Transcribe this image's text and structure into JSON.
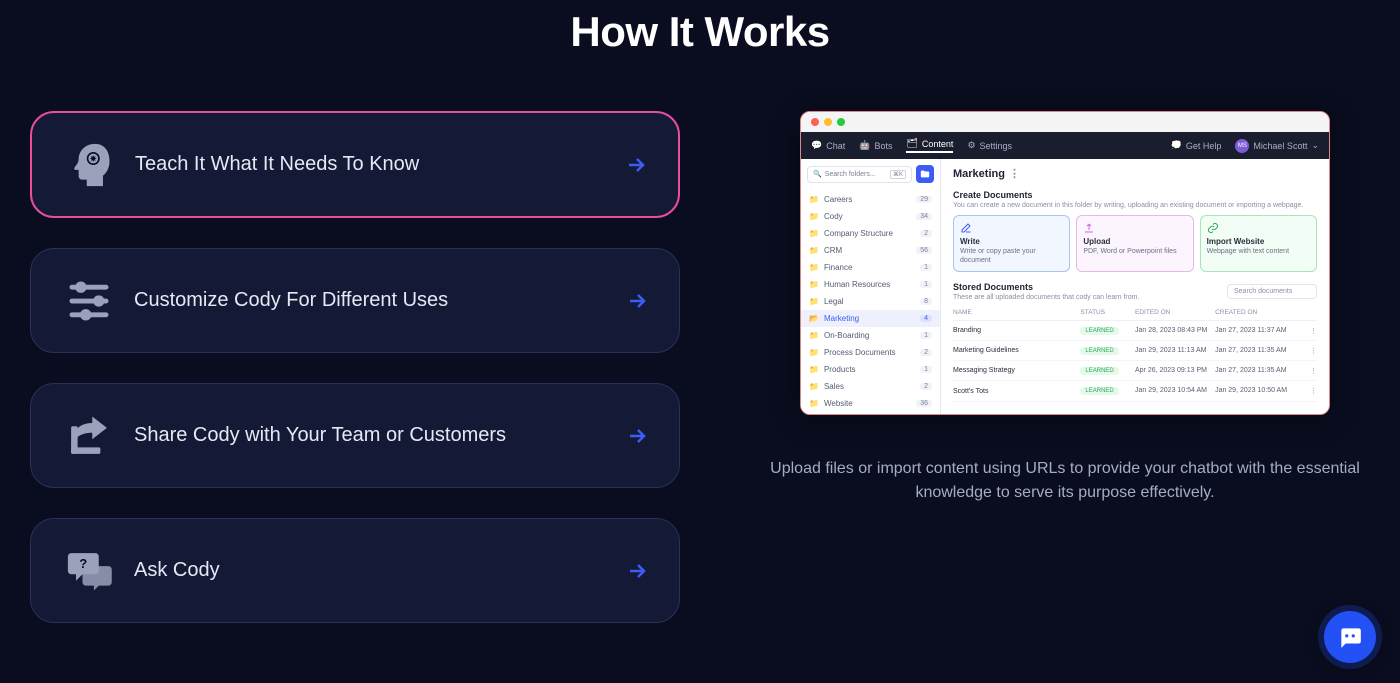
{
  "title": "How It Works",
  "steps": [
    {
      "label": "Teach It What It Needs To Know",
      "active": true
    },
    {
      "label": "Customize Cody For Different Uses",
      "active": false
    },
    {
      "label": "Share Cody with Your Team or Customers",
      "active": false
    },
    {
      "label": "Ask Cody",
      "active": false
    }
  ],
  "description": "Upload files or import content using URLs to provide your chatbot with the essential knowledge to serve its purpose effectively.",
  "app": {
    "topbar": {
      "chat": "Chat",
      "bots": "Bots",
      "content": "Content",
      "settings": "Settings",
      "gethelp": "Get Help",
      "user": "Michael Scott",
      "user_initials": "MS"
    },
    "sidebar": {
      "search_placeholder": "Search folders...",
      "kbd": "⌘K",
      "folders": [
        {
          "name": "Careers",
          "count": 29
        },
        {
          "name": "Cody",
          "count": 34
        },
        {
          "name": "Company Structure",
          "count": 2
        },
        {
          "name": "CRM",
          "count": 56
        },
        {
          "name": "Finance",
          "count": 1
        },
        {
          "name": "Human Resources",
          "count": 1
        },
        {
          "name": "Legal",
          "count": 8
        },
        {
          "name": "Marketing",
          "count": 4,
          "selected": true
        },
        {
          "name": "On-Boarding",
          "count": 1
        },
        {
          "name": "Process Documents",
          "count": 2
        },
        {
          "name": "Products",
          "count": 1
        },
        {
          "name": "Sales",
          "count": 2
        },
        {
          "name": "Website",
          "count": 36
        }
      ]
    },
    "panel": {
      "title": "Marketing",
      "create": {
        "title": "Create Documents",
        "sub": "You can create a new document in this folder by writing, uploading an existing document or importing a webpage.",
        "write": {
          "title": "Write",
          "sub": "Write or copy paste your document"
        },
        "upload": {
          "title": "Upload",
          "sub": "PDF, Word or Powerpoint files"
        },
        "import": {
          "title": "Import Website",
          "sub": "Webpage with text content"
        }
      },
      "stored": {
        "title": "Stored Documents",
        "sub": "These are all uploaded documents that cody can learn from.",
        "search_placeholder": "Search documents"
      },
      "table": {
        "headers": {
          "name": "NAME",
          "status": "STATUS",
          "edited": "EDITED ON",
          "created": "CREATED ON"
        },
        "rows": [
          {
            "name": "Branding",
            "status": "LEARNED",
            "edited": "Jan 28, 2023 08:43 PM",
            "created": "Jan 27, 2023 11:37 AM"
          },
          {
            "name": "Marketing Guidelines",
            "status": "LEARNED",
            "edited": "Jan 29, 2023 11:13 AM",
            "created": "Jan 27, 2023 11:35 AM"
          },
          {
            "name": "Messaging Strategy",
            "status": "LEARNED",
            "edited": "Apr 26, 2023 09:13 PM",
            "created": "Jan 27, 2023 11:35 AM"
          },
          {
            "name": "Scott's Tots",
            "status": "LEARNED",
            "edited": "Jan 29, 2023 10:54 AM",
            "created": "Jan 29, 2023 10:50 AM"
          }
        ]
      }
    }
  }
}
